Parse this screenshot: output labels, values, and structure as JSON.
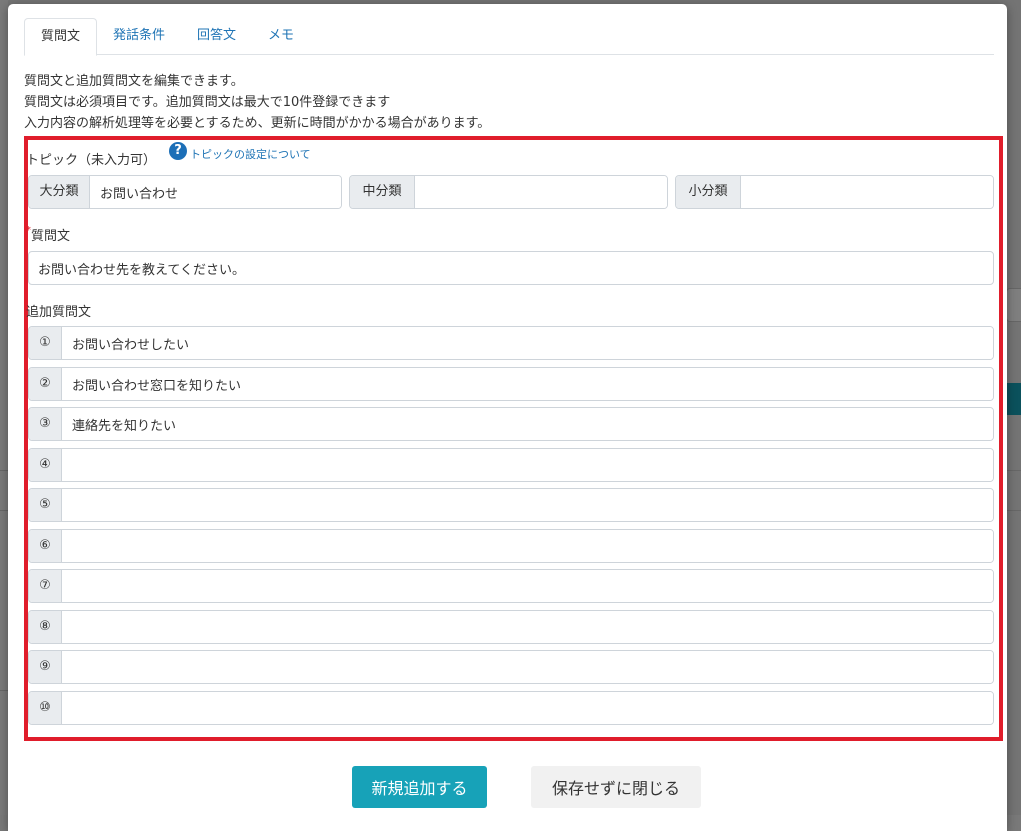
{
  "tabs": [
    {
      "label": "質問文",
      "active": true
    },
    {
      "label": "発話条件",
      "active": false
    },
    {
      "label": "回答文",
      "active": false
    },
    {
      "label": "メモ",
      "active": false
    }
  ],
  "description": [
    "質問文と追加質問文を編集できます。",
    "質問文は必須項目です。追加質問文は最大で10件登録できます",
    "入力内容の解析処理等を必要とするため、更新に時間がかかる場合があります。"
  ],
  "topic": {
    "label": "トピック（未入力可）",
    "help_icon": "question-circle-icon",
    "help_link": "トピックの設定について",
    "large": {
      "label": "大分類",
      "value": "お問い合わせ"
    },
    "medium": {
      "label": "中分類",
      "value": ""
    },
    "small": {
      "label": "小分類",
      "value": ""
    }
  },
  "question": {
    "required_mark": "*",
    "label": "質問文",
    "value": "お問い合わせ先を教えてください。"
  },
  "additional": {
    "label": "追加質問文",
    "items": [
      {
        "num": "①",
        "value": "お問い合わせしたい"
      },
      {
        "num": "②",
        "value": "お問い合わせ窓口を知りたい"
      },
      {
        "num": "③",
        "value": "連絡先を知りたい"
      },
      {
        "num": "④",
        "value": ""
      },
      {
        "num": "⑤",
        "value": ""
      },
      {
        "num": "⑥",
        "value": ""
      },
      {
        "num": "⑦",
        "value": ""
      },
      {
        "num": "⑧",
        "value": ""
      },
      {
        "num": "⑨",
        "value": ""
      },
      {
        "num": "⑩",
        "value": ""
      }
    ]
  },
  "buttons": {
    "add": "新規追加する",
    "close": "保存せずに閉じる"
  },
  "colors": {
    "accent": "#17a2b8",
    "highlight": "#e01d2b",
    "link": "#1f74b5"
  }
}
